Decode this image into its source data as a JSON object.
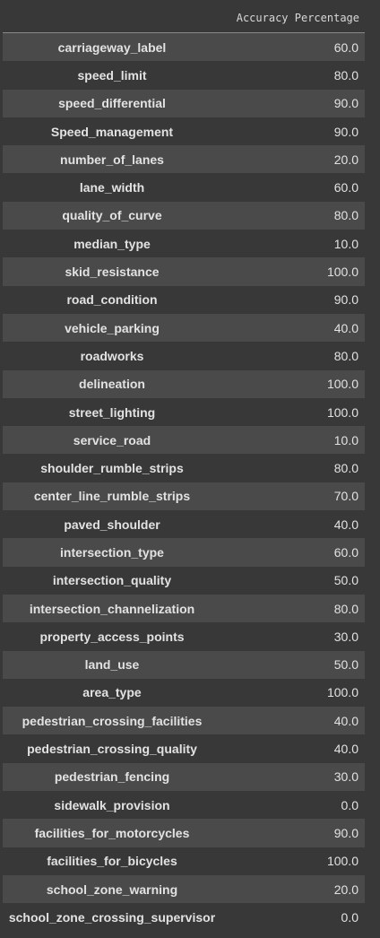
{
  "table": {
    "column_header": "Accuracy Percentage",
    "rows": [
      {
        "label": "carriageway_label",
        "value": "60.0"
      },
      {
        "label": "speed_limit",
        "value": "80.0"
      },
      {
        "label": "speed_differential",
        "value": "90.0"
      },
      {
        "label": "Speed_management",
        "value": "90.0"
      },
      {
        "label": "number_of_lanes",
        "value": "20.0"
      },
      {
        "label": "lane_width",
        "value": "60.0"
      },
      {
        "label": "quality_of_curve",
        "value": "80.0"
      },
      {
        "label": "median_type",
        "value": "10.0"
      },
      {
        "label": "skid_resistance",
        "value": "100.0"
      },
      {
        "label": "road_condition",
        "value": "90.0"
      },
      {
        "label": "vehicle_parking",
        "value": "40.0"
      },
      {
        "label": "roadworks",
        "value": "80.0"
      },
      {
        "label": "delineation",
        "value": "100.0"
      },
      {
        "label": "street_lighting",
        "value": "100.0"
      },
      {
        "label": "service_road",
        "value": "10.0"
      },
      {
        "label": "shoulder_rumble_strips",
        "value": "80.0"
      },
      {
        "label": "center_line_rumble_strips",
        "value": "70.0"
      },
      {
        "label": "paved_shoulder",
        "value": "40.0"
      },
      {
        "label": "intersection_type",
        "value": "60.0"
      },
      {
        "label": "intersection_quality",
        "value": "50.0"
      },
      {
        "label": "intersection_channelization",
        "value": "80.0"
      },
      {
        "label": "property_access_points",
        "value": "30.0"
      },
      {
        "label": "land_use",
        "value": "50.0"
      },
      {
        "label": "area_type",
        "value": "100.0"
      },
      {
        "label": "pedestrian_crossing_facilities",
        "value": "40.0"
      },
      {
        "label": "pedestrian_crossing_quality",
        "value": "40.0"
      },
      {
        "label": "pedestrian_fencing",
        "value": "30.0"
      },
      {
        "label": "sidewalk_provision",
        "value": "0.0"
      },
      {
        "label": "facilities_for_motorcycles",
        "value": "90.0"
      },
      {
        "label": "facilities_for_bicycles",
        "value": "100.0"
      },
      {
        "label": "school_zone_warning",
        "value": "20.0"
      },
      {
        "label": "school_zone_crossing_supervisor",
        "value": "0.0"
      }
    ]
  },
  "colors": {
    "background": "#383838",
    "row_stripe": "#4a4a4a",
    "text": "#e2e2e2"
  }
}
